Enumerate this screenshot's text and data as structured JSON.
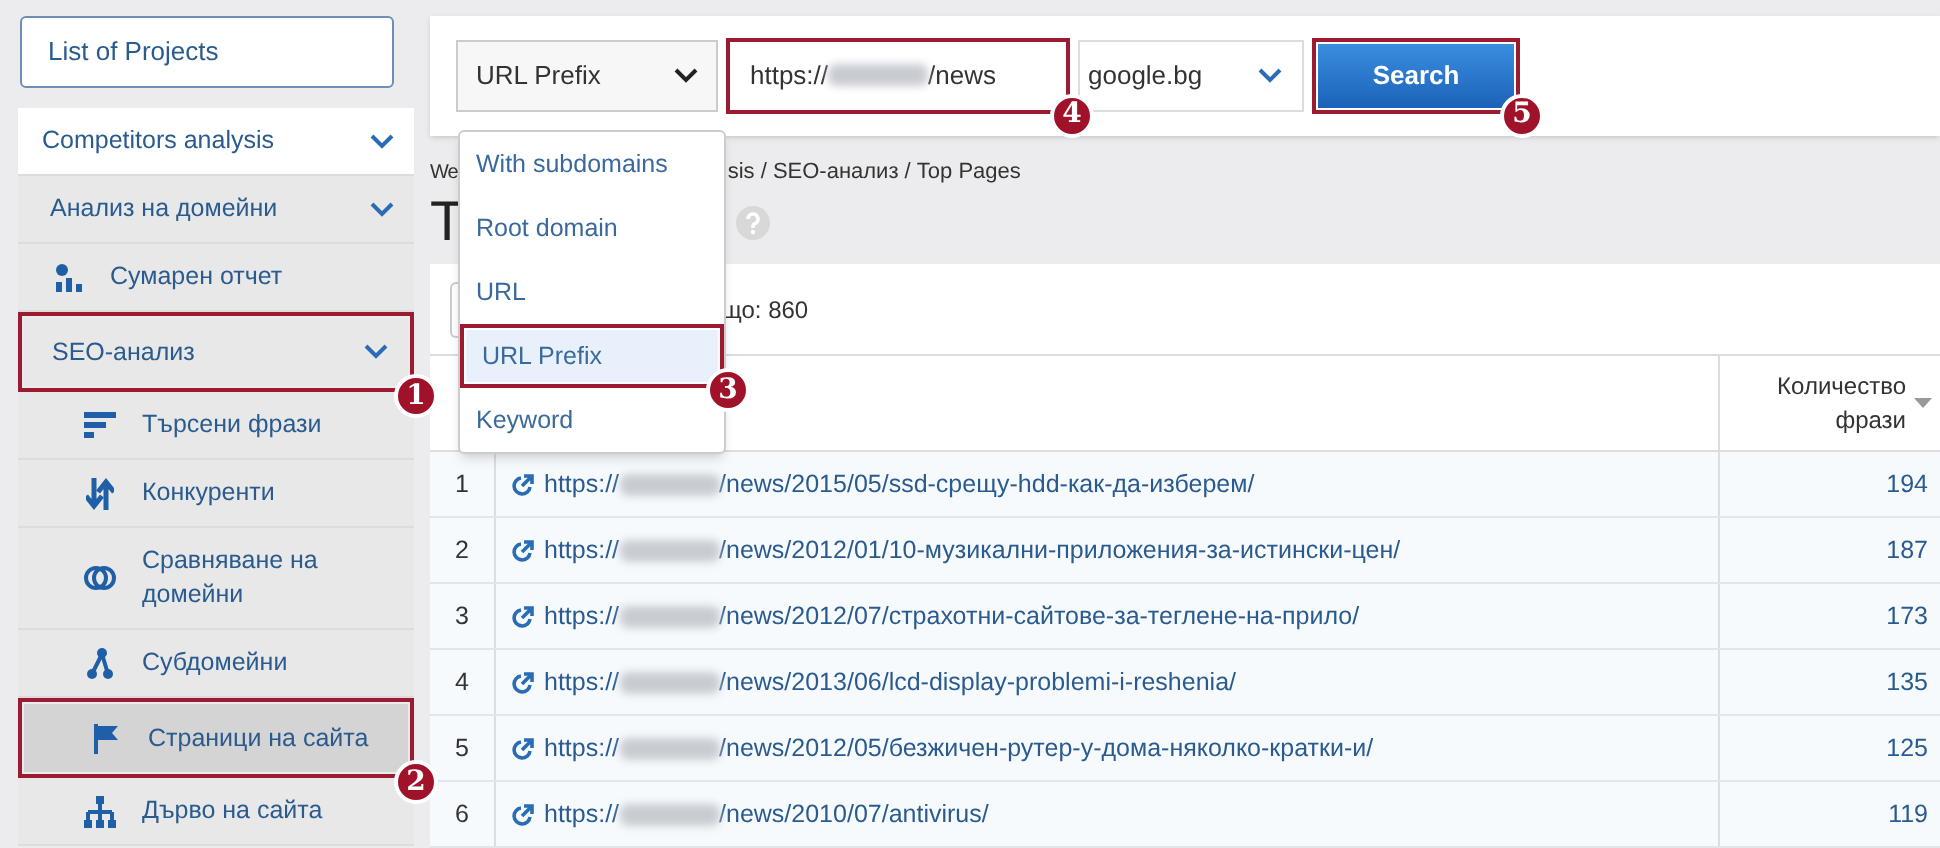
{
  "sidebar": {
    "projects_button": "List of Projects",
    "items": [
      {
        "kind": "section",
        "label": "Competitors analysis",
        "selected": false
      },
      {
        "kind": "section",
        "label": "Анализ на домейни",
        "selected": false
      },
      {
        "kind": "item",
        "label": "Сумарен отчет",
        "selected": false
      },
      {
        "kind": "section",
        "label": "SEO-анализ",
        "selected": false,
        "step": "1"
      },
      {
        "kind": "subitem",
        "label": "Търсени фрази",
        "selected": false
      },
      {
        "kind": "subitem",
        "label": "Конкуренти",
        "selected": false
      },
      {
        "kind": "subitem",
        "label": "Сравняване на домейни",
        "selected": false
      },
      {
        "kind": "subitem",
        "label": "Субдомейни",
        "selected": false
      },
      {
        "kind": "subitem",
        "label": "Страници на сайта",
        "selected": true,
        "step": "2"
      },
      {
        "kind": "subitem",
        "label": "Дърво на сайта",
        "selected": false
      }
    ]
  },
  "search_bar": {
    "mode_select": "URL Prefix",
    "mode_menu": [
      {
        "label": "With subdomains",
        "selected": false
      },
      {
        "label": "Root domain",
        "selected": false
      },
      {
        "label": "URL",
        "selected": false
      },
      {
        "label": "URL Prefix",
        "selected": true,
        "step": "3"
      },
      {
        "label": "Keyword",
        "selected": false
      }
    ],
    "url_field": {
      "prefix": "https://",
      "suffix": "/news",
      "step": "4"
    },
    "engine_select": "google.bg",
    "search_button": {
      "label": "Search",
      "step": "5"
    }
  },
  "breadcrumb": {
    "start": "We",
    "end": "sis / SEO-анализ / Top Pages"
  },
  "page_title": "T",
  "result_count": "що: 860",
  "table": {
    "columns": [
      "Количество\nфрази"
    ],
    "rows": [
      {
        "index": "1",
        "url_prefix": "https://",
        "url_path": "/news/2015/05/ssd-срещу-hdd-как-да-изберем/",
        "phrases": "194"
      },
      {
        "index": "2",
        "url_prefix": "https://",
        "url_path": "/news/2012/01/10-музикални-приложения-за-истински-цен/",
        "phrases": "187"
      },
      {
        "index": "3",
        "url_prefix": "https://",
        "url_path": "/news/2012/07/страхотни-сайтове-за-теглене-на-прило/",
        "phrases": "173"
      },
      {
        "index": "4",
        "url_prefix": "https://",
        "url_path": "/news/2013/06/lcd-display-problemi-i-reshenia/",
        "phrases": "135"
      },
      {
        "index": "5",
        "url_prefix": "https://",
        "url_path": "/news/2012/05/безжичен-рутер-у-дома-няколко-кратки-и/",
        "phrases": "125"
      },
      {
        "index": "6",
        "url_prefix": "https://",
        "url_path": "/news/2010/07/antivirus/",
        "phrases": "119"
      }
    ]
  }
}
